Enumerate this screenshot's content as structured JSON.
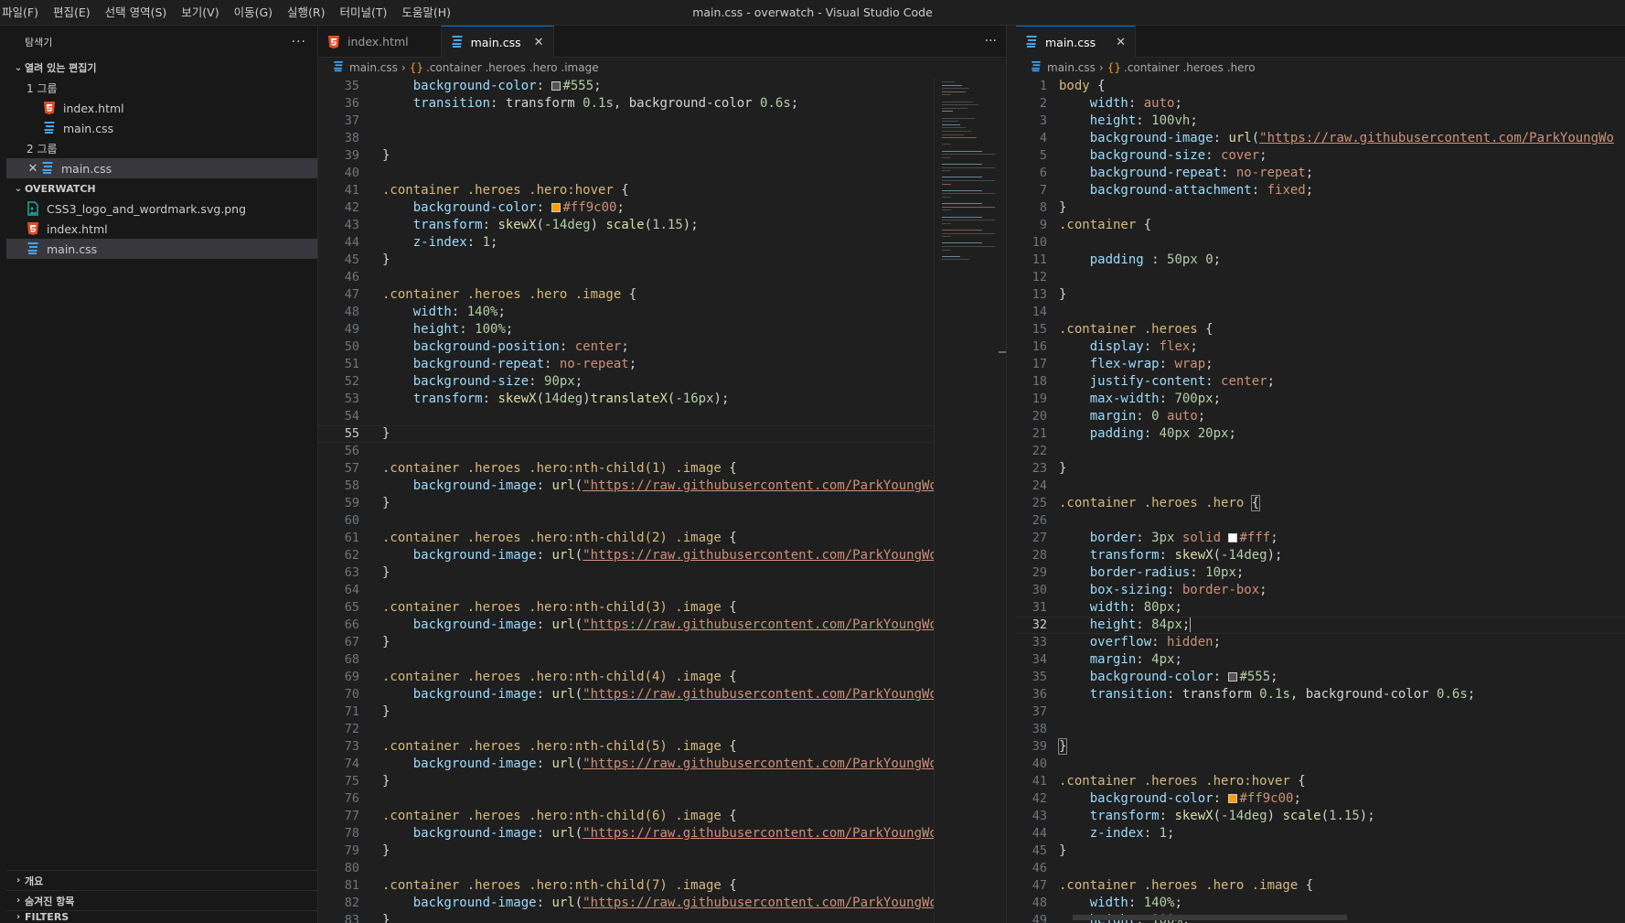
{
  "menu": [
    "파일(F)",
    "편집(E)",
    "선택 영역(S)",
    "보기(V)",
    "이동(G)",
    "실행(R)",
    "터미널(T)",
    "도움말(H)"
  ],
  "window_title": "main.css - overwatch - Visual Studio Code",
  "sidebar": {
    "title": "탐색기",
    "open_editors_label": "열려 있는 편집기",
    "group1_label": "1 그룹",
    "group1_files": [
      "index.html",
      "main.css"
    ],
    "group2_label": "2 그룹",
    "group2_files": [
      "main.css"
    ],
    "project_label": "OVERWATCH",
    "project_files": [
      "CSS3_logo_and_wordmark.svg.png",
      "index.html",
      "main.css"
    ],
    "outline_label": "개요",
    "hidden_label": "숨겨진 항목",
    "filters_label": "FILTERS"
  },
  "editor_left": {
    "tabs": [
      "index.html",
      "main.css"
    ],
    "breadcrumb": [
      "main.css",
      ".container .heroes .hero .image"
    ],
    "current_line": 55
  },
  "editor_right": {
    "tabs": [
      "main.css"
    ],
    "breadcrumb": [
      "main.css",
      ".container .heroes .hero"
    ],
    "current_line": 32
  },
  "colors": {
    "accent": "#0078d4",
    "swatch_orange": "#ff9c00",
    "swatch_gray": "#555555",
    "swatch_white": "#ffffff"
  },
  "url_text": "\"https://raw.githubusercontent.com/ParkYoungWo"
}
